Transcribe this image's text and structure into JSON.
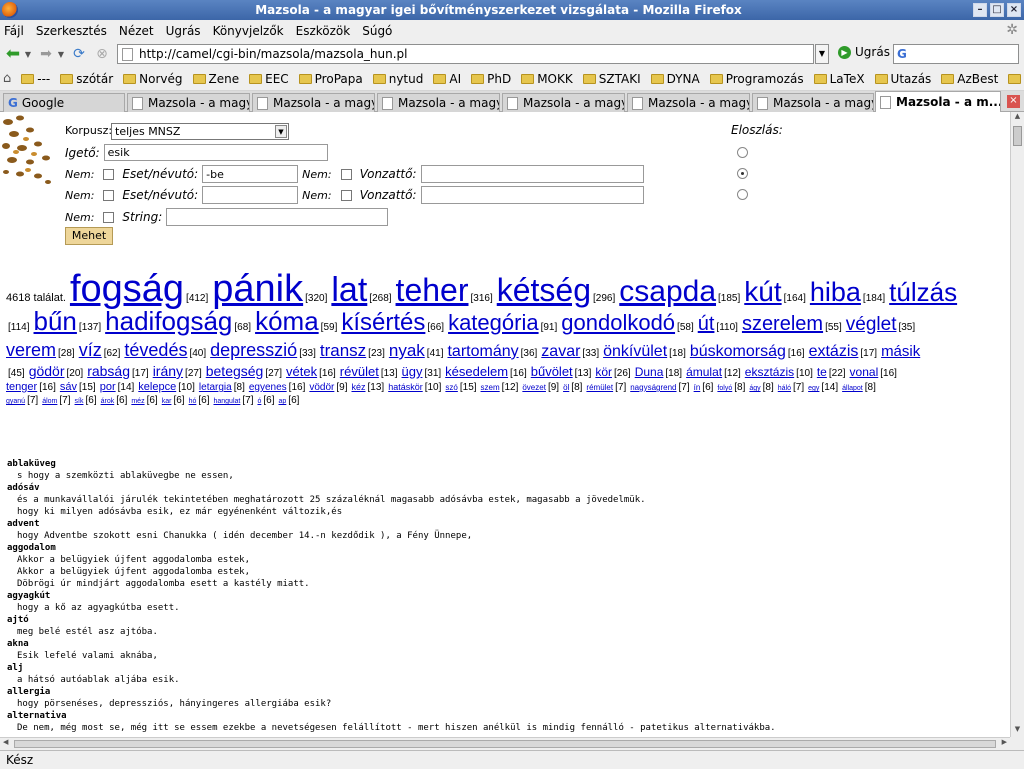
{
  "window": {
    "title": "Mazsola - a magyar igei bővítményszerkezet vizsgálata - Mozilla Firefox"
  },
  "menu": [
    "Fájl",
    "Szerkesztés",
    "Nézet",
    "Ugrás",
    "Könyvjelzők",
    "Eszközök",
    "Súgó"
  ],
  "nav": {
    "url": "http://camel/cgi-bin/mazsola/mazsola_hun.pl",
    "go_label": "Ugrás"
  },
  "bookmarks": [
    "---",
    "szótár",
    "Norvég",
    "Zene",
    "EEC",
    "ProPapa",
    "nytud",
    "AI",
    "PhD",
    "MOKK",
    "SZTAKI",
    "DYNA",
    "Programozás",
    "LaTeX",
    "Utazás",
    "AzBest",
    "Olvas"
  ],
  "tabs": [
    {
      "label": "Google"
    },
    {
      "label": "Mazsola - a magy..."
    },
    {
      "label": "Mazsola - a magy..."
    },
    {
      "label": "Mazsola - a magy..."
    },
    {
      "label": "Mazsola - a magy..."
    },
    {
      "label": "Mazsola - a magy..."
    },
    {
      "label": "Mazsola - a magy..."
    },
    {
      "label": "Mazsola - a m..."
    }
  ],
  "form": {
    "korpus_label": "Korpusz:",
    "korpus_value": "teljes MNSZ",
    "igeto_label": "Igető:",
    "igeto_value": "esik",
    "nem_label": "Nem:",
    "eset_label": "Eset/névutó:",
    "vonzatto_label": "Vonzattő:",
    "string_label": "String:",
    "row1_eset_value": "-be",
    "submit_label": "Mehet",
    "eloszlas_label": "Eloszlás:"
  },
  "results": {
    "count_text": "4618 találat.",
    "cloud": [
      [
        [
          "fogság",
          "412",
          38
        ],
        [
          "pánik",
          "320",
          38
        ],
        [
          "lat",
          "268",
          34
        ],
        [
          "teher",
          "316",
          32
        ],
        [
          "kétség",
          "296",
          32
        ],
        [
          "csapda",
          "185",
          30
        ],
        [
          "kút",
          "164",
          28
        ],
        [
          "hiba",
          "184",
          27
        ],
        [
          "túlzás",
          "",
          26
        ]
      ],
      [
        [
          "",
          "114",
          0
        ],
        [
          "bűn",
          "137",
          26
        ],
        [
          "hadifogság",
          "68",
          26
        ],
        [
          "kóma",
          "59",
          26
        ],
        [
          "kísértés",
          "66",
          24
        ],
        [
          "kategória",
          "91",
          22
        ],
        [
          "gondolkodó",
          "58",
          22
        ],
        [
          "út",
          "110",
          20
        ],
        [
          "szerelem",
          "55",
          20
        ],
        [
          "véglet",
          "35",
          19
        ]
      ],
      [
        [
          "verem",
          "28",
          18
        ],
        [
          "víz",
          "62",
          18
        ],
        [
          "tévedés",
          "40",
          18
        ],
        [
          "depresszió",
          "33",
          18
        ],
        [
          "transz",
          "23",
          17
        ],
        [
          "nyak",
          "41",
          17
        ],
        [
          "tartomány",
          "36",
          16
        ],
        [
          "zavar",
          "33",
          16
        ],
        [
          "önkívület",
          "18",
          16
        ],
        [
          "búskomorság",
          "16",
          16
        ],
        [
          "extázis",
          "17",
          16
        ],
        [
          "másik",
          "",
          15
        ]
      ],
      [
        [
          "",
          "45",
          0
        ],
        [
          "gödör",
          "20",
          14
        ],
        [
          "rabság",
          "17",
          14
        ],
        [
          "irány",
          "27",
          14
        ],
        [
          "betegség",
          "27",
          14
        ],
        [
          "vétek",
          "16",
          13
        ],
        [
          "révület",
          "13",
          13
        ],
        [
          "ügy",
          "31",
          13
        ],
        [
          "késedelem",
          "16",
          13
        ],
        [
          "bűvölet",
          "13",
          13
        ],
        [
          "kör",
          "26",
          12
        ],
        [
          "Duna",
          "18",
          12
        ],
        [
          "ámulat",
          "12",
          12
        ],
        [
          "eksztázis",
          "10",
          12
        ],
        [
          "te",
          "22",
          12
        ],
        [
          "vonal",
          "16",
          12
        ]
      ],
      [
        [
          "tenger",
          "16",
          11
        ],
        [
          "sáv",
          "15",
          11
        ],
        [
          "por",
          "14",
          11
        ],
        [
          "kelepce",
          "10",
          11
        ],
        [
          "letargia",
          "8",
          10
        ],
        [
          "egyenes",
          "16",
          10
        ],
        [
          "vödör",
          "9",
          10
        ],
        [
          "kéz",
          "13",
          9
        ],
        [
          "hatáskör",
          "10",
          9
        ],
        [
          "szó",
          "15",
          8
        ],
        [
          "szem",
          "12",
          8
        ],
        [
          "övezet",
          "9",
          8
        ],
        [
          "öl",
          "8",
          8
        ],
        [
          "rémület",
          "7",
          8
        ],
        [
          "nagyságrend",
          "7",
          8
        ],
        [
          "ín",
          "6",
          8
        ],
        [
          "folyó",
          "8",
          7
        ],
        [
          "ágy",
          "8",
          7
        ],
        [
          "háló",
          "7",
          7
        ],
        [
          "egy",
          "14",
          7
        ],
        [
          "állapot",
          "8",
          7
        ]
      ],
      [
        [
          "gyanú",
          "7",
          7
        ],
        [
          "álom",
          "7",
          7
        ],
        [
          "sík",
          "6",
          7
        ],
        [
          "árok",
          "6",
          7
        ],
        [
          "méz",
          "6",
          7
        ],
        [
          "kar",
          "6",
          7
        ],
        [
          "hó",
          "6",
          7
        ],
        [
          "hangulat",
          "7",
          7
        ],
        [
          "ó",
          "6",
          7
        ],
        [
          "ap",
          "6",
          7
        ]
      ]
    ],
    "concordance": [
      {
        "head": "ablaküveg",
        "lines": [
          "s hogy a szemközti ablaküvegbe ne essen,"
        ]
      },
      {
        "head": "adósáv",
        "lines": [
          "és a munkavállalói járulék tekintetében meghatározott 25 százaléknál magasabb adósávba estek, magasabb a jövedelmük.",
          "hogy ki milyen adósávba esik, ez már egyénenként változik,és"
        ]
      },
      {
        "head": "advent",
        "lines": [
          "hogy Adventbe szokott esni Chanukka ( idén december 14.-n kezdődik ), a Fény Ünnepe,"
        ]
      },
      {
        "head": "aggodalom",
        "lines": [
          "Akkor a belügyiek újfent aggodalomba estek,",
          "Akkor a belügyiek újfent aggodalomba estek,",
          "Döbrögi úr mindjárt aggodalomba esett a kastély miatt."
        ]
      },
      {
        "head": "agyagkút",
        "lines": [
          "hogy a kő az agyagkútba esett."
        ]
      },
      {
        "head": "ajtó",
        "lines": [
          "meg belé estél asz ajtóba."
        ]
      },
      {
        "head": "akna",
        "lines": [
          "Esik lefelé valami aknába,"
        ]
      },
      {
        "head": "alj",
        "lines": [
          "a hátsó autóablak aljába esik."
        ]
      },
      {
        "head": "allergia",
        "lines": [
          "hogy pörsenéses, depressziós, hányingeres allergiába esik?"
        ]
      },
      {
        "head": "alternativa",
        "lines": [
          "De nem, még most se, még itt se essem ezekbe a nevetségesen felállított - mert hiszen anélkül is mindig fennálló - patetikus alternativákba."
        ]
      }
    ]
  },
  "status": "Kész"
}
